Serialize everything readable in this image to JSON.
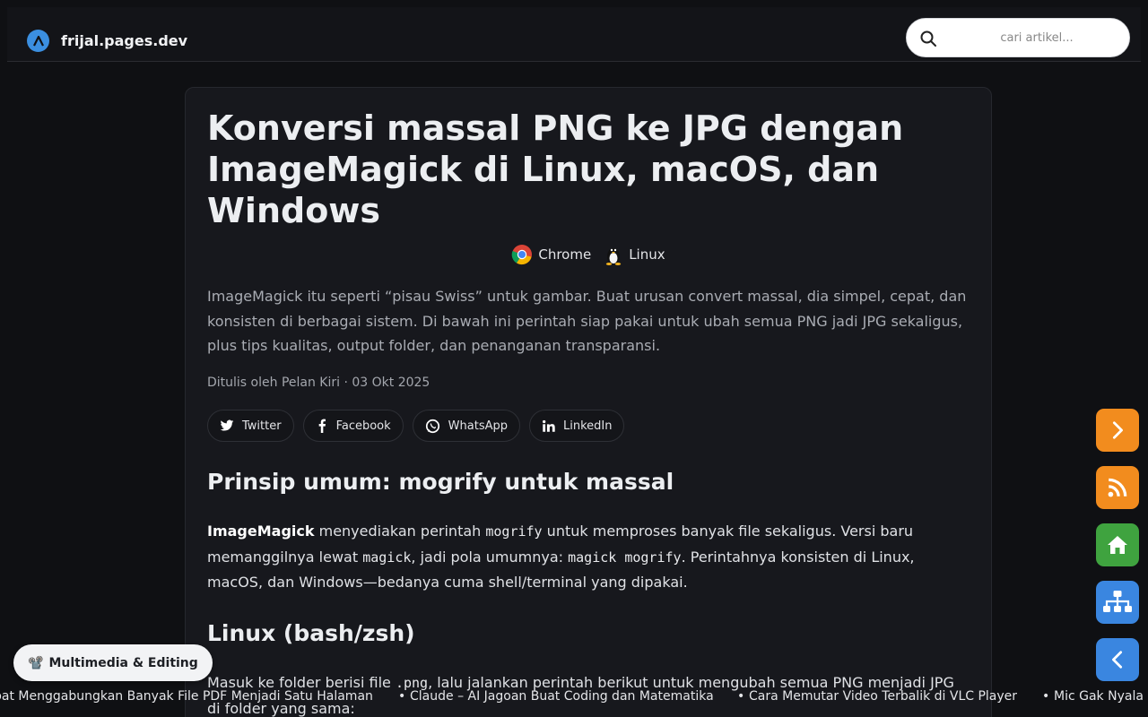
{
  "header": {
    "site_name": "frijal.pages.dev",
    "search_placeholder": "cari artikel..."
  },
  "article": {
    "title": "Konversi massal PNG ke JPG dengan ImageMagick di Linux, macOS, dan Windows",
    "tags": [
      {
        "label": "Chrome",
        "icon": "chrome-icon"
      },
      {
        "label": "Linux",
        "icon": "tux-icon"
      }
    ],
    "description": "ImageMagick itu seperti “pisau Swiss” untuk gambar. Buat urusan convert massal, dia simpel, cepat, dan konsisten di berbagai sistem. Di bawah ini perintah siap pakai untuk ubah semua PNG jadi JPG sekaligus, plus tips kualitas, output folder, dan penanganan transparansi.",
    "byline": "Ditulis oleh Pelan Kiri · 03 Okt 2025",
    "share": {
      "twitter": "Twitter",
      "facebook": "Facebook",
      "whatsapp": "WhatsApp",
      "linkedin": "LinkedIn"
    },
    "section1": {
      "heading": "Prinsip umum: mogrify untuk massal",
      "p_bold": "ImageMagick",
      "p_1": " menyediakan perintah ",
      "code_1": "mogrify",
      "p_2": " untuk memproses banyak file sekaligus. Versi baru memanggilnya lewat ",
      "code_2": "magick",
      "p_3": ", jadi pola umumnya: ",
      "code_3": "magick mogrify",
      "p_4": ". Perintahnya konsisten di Linux, macOS, dan Windows—bedanya cuma shell/terminal yang dipakai."
    },
    "section2": {
      "heading": "Linux (bash/zsh)",
      "p_1": "Masuk ke folder berisi file ",
      "code_1": ".png",
      "p_2": ", lalu jalankan perintah berikut untuk mengubah semua PNG menjadi JPG di folder yang sama:"
    }
  },
  "category_badge": {
    "emoji": "📽️",
    "label": "Multimedia & Editing"
  },
  "ticker": [
    "bat Menggabungkan Banyak File PDF Menjadi Satu Halaman",
    "Claude – AI Jagoan Buat Coding dan Matematika",
    "Cara Memutar Video Terbalik di VLC Player",
    "Mic Gak Nyala di"
  ],
  "side_buttons": [
    {
      "icon": "chevron-right-icon",
      "color": "#f28c1e"
    },
    {
      "icon": "rss-icon",
      "color": "#f28c1e"
    },
    {
      "icon": "home-icon",
      "color": "#3fa33f"
    },
    {
      "icon": "sitemap-icon",
      "color": "#3a86e0"
    },
    {
      "icon": "chevron-left-icon",
      "color": "#3a86e0"
    }
  ]
}
